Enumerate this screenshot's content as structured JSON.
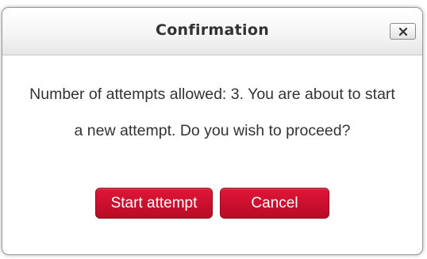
{
  "dialog": {
    "title": "Confirmation",
    "close_icon": "close-icon",
    "message": "Number of attempts allowed: 3. You are about to start a new attempt. Do you wish to proceed?",
    "buttons": {
      "start_label": "Start attempt",
      "cancel_label": "Cancel"
    }
  },
  "colors": {
    "button_red": "#cc1030",
    "header_gray": "#ececec",
    "text": "#333333"
  }
}
